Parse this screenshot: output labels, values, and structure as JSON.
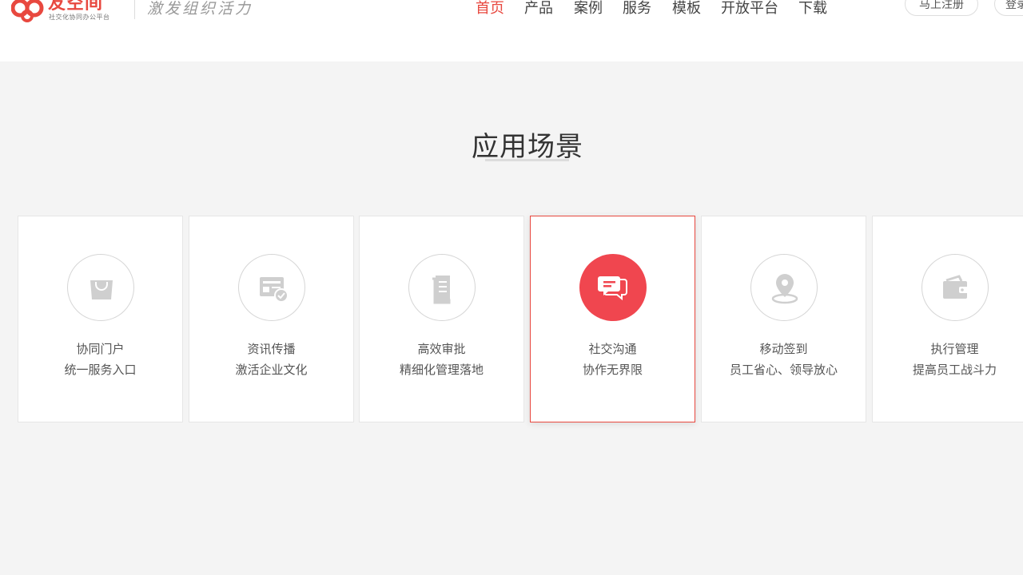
{
  "header": {
    "logo_name": "友空间",
    "logo_sub": "社交化协同办公平台",
    "slogan": "激发组织活力",
    "nav": [
      "首页",
      "产品",
      "案例",
      "服务",
      "模板",
      "开放平台",
      "下载"
    ],
    "active_nav": "首页",
    "register_label": "马上注册",
    "login_label": "登录"
  },
  "section": {
    "title": "应用场景"
  },
  "cards": [
    {
      "icon": "shopping-bag-icon",
      "line1": "协同门户",
      "line2": "统一服务入口"
    },
    {
      "icon": "news-check-icon",
      "line1": "资讯传播",
      "line2": "激活企业文化"
    },
    {
      "icon": "document-icon",
      "line1": "高效审批",
      "line2": "精细化管理落地"
    },
    {
      "icon": "chat-bubbles-icon",
      "line1": "社交沟通",
      "line2": "协作无界限",
      "active": true
    },
    {
      "icon": "location-pin-icon",
      "line1": "移动签到",
      "line2": "员工省心、领导放心"
    },
    {
      "icon": "wallet-icon",
      "line1": "执行管理",
      "line2": "提高员工战斗力"
    }
  ],
  "colors": {
    "accent": "#e8483f",
    "icon_gray": "#cfcfcf",
    "active_circle": "#f0464f"
  },
  "status_bar": {
    "left": "",
    "right": ""
  }
}
